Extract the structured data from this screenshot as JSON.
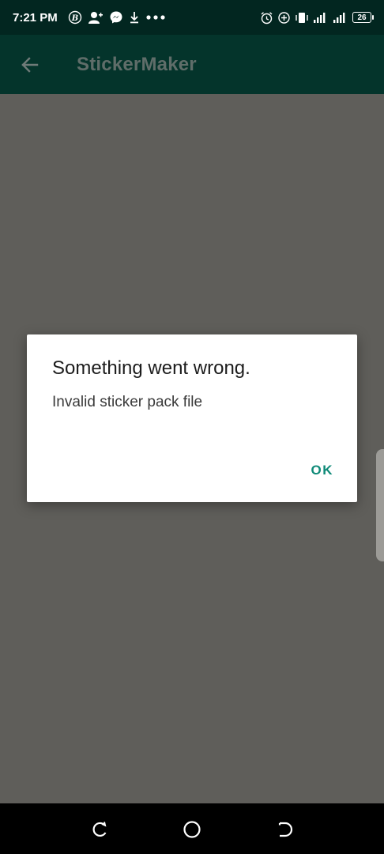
{
  "status_bar": {
    "time": "7:21 PM",
    "battery": "26",
    "icons_left": [
      "b-circle-icon",
      "person-add-icon",
      "messenger-icon",
      "download-icon",
      "more-dots-icon"
    ],
    "icons_right": [
      "alarm-icon",
      "data-saver-icon",
      "vibrate-icon",
      "signal-icon",
      "signal-icon",
      "battery-icon"
    ]
  },
  "app_bar": {
    "title": "StickerMaker",
    "back_icon": "arrow-left-icon"
  },
  "dialog": {
    "title": "Something went wrong.",
    "message": "Invalid sticker pack file",
    "ok_label": "OK"
  },
  "nav_bar": {
    "icons": [
      "recents-icon",
      "home-icon",
      "back-icon"
    ]
  },
  "colors": {
    "status_bar_bg": "#022620",
    "app_bar_bg": "#04342b",
    "scrim": "#5f5e5a",
    "accent": "#0f8a78"
  }
}
